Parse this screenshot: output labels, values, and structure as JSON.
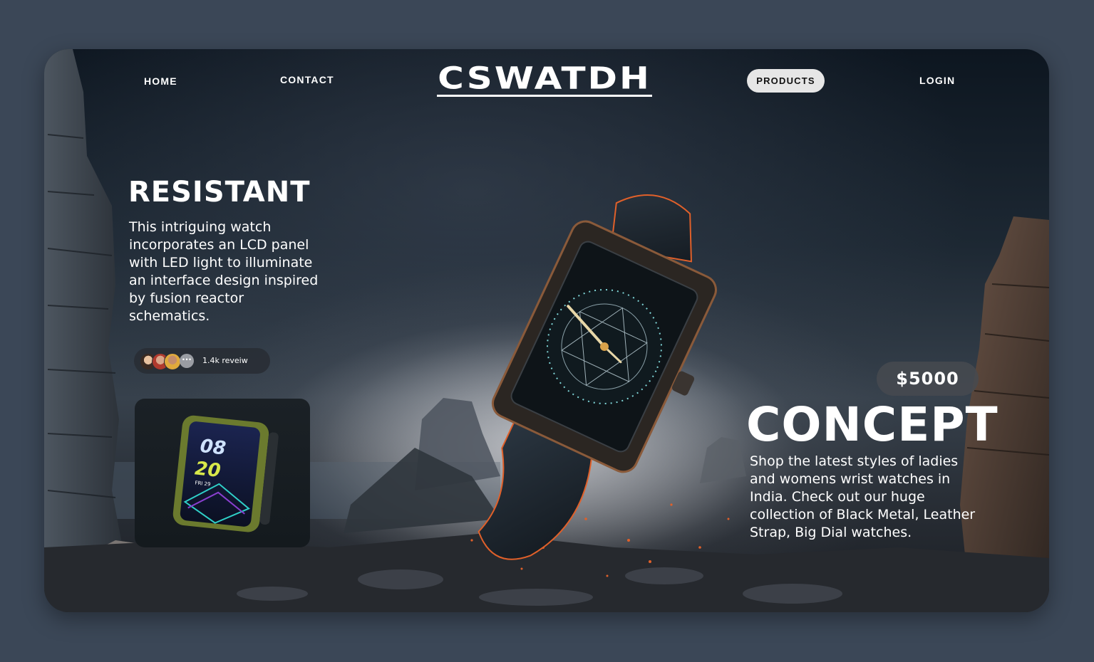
{
  "nav": {
    "home": "HOME",
    "contact": "CONTACT",
    "brand": "CSWATDH",
    "products": "PRODUCTS",
    "login": "LOGIN"
  },
  "left": {
    "heading": "RESISTANT",
    "description": "This intriguing watch incorporates an LCD panel with LED light to illuminate an interface design inspired by fusion reactor schematics.",
    "reviews": "1.4k reveiw",
    "thumbnail": {
      "hour": "08",
      "minute": "20",
      "date": "FRI 29"
    }
  },
  "right": {
    "price": "$5000",
    "heading": "CONCEPT",
    "description": "Shop the latest styles of ladies and womens wrist watches in India. Check out our huge collection of Black Metal, Leather Strap, Big Dial watches."
  },
  "colors": {
    "page_bg": "#3b4757",
    "accent_ember": "#e0602a",
    "products_pill": "#e6e6e6"
  }
}
